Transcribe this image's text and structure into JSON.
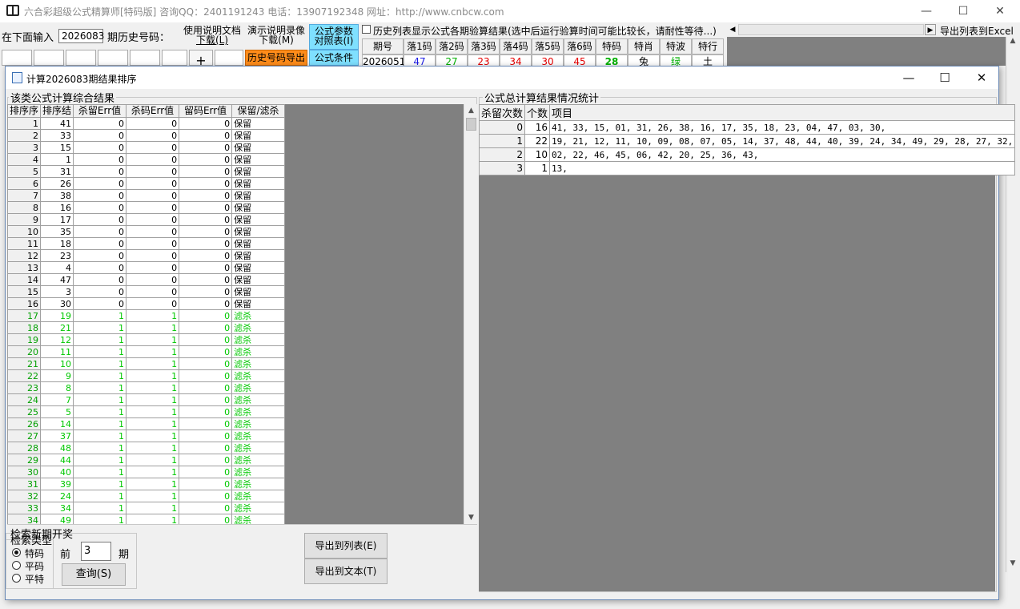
{
  "main_window": {
    "title": "六合彩超级公式精算师[特码版]  咨询QQ：2401191243  电话：13907192348  网址：http://www.cnbcw.com",
    "input_label": "在下面输入",
    "period_value": "2026083",
    "history_label": "期历史号码：",
    "btn_manual_line1": "使用说明文档",
    "btn_manual_line2": "下载(L)",
    "btn_video_line1": "演示说明录像",
    "btn_video_line2": "下载(M)",
    "btn_formula_line1": "公式参数",
    "btn_formula_line2": "对照表(I)",
    "btn_history_export": "历史号码导出",
    "btn_formula_cond": "公式条件",
    "checkbox_label": "历史列表显示公式各期验算结果(选中后运行验算时间可能比较长，请耐性等待...)",
    "export_excel": "导出列表到Excel",
    "plus": "+",
    "history_headers": [
      "期号",
      "落1码",
      "落2码",
      "落3码",
      "落4码",
      "落5码",
      "落6码",
      "特码",
      "特肖",
      "特波",
      "特行"
    ],
    "history_row": [
      "2026051",
      "47",
      "27",
      "23",
      "34",
      "30",
      "45",
      "28",
      "兔",
      "绿",
      "土"
    ],
    "history_colors": [
      "#000000",
      "#1a1ae6",
      "#00b000",
      "#e60000",
      "#e60000",
      "#e60000",
      "#e60000",
      "#00b000",
      "#000000",
      "#00b000",
      "#000000"
    ]
  },
  "dialog": {
    "title": "计算2026083期结果排序",
    "left_group_label": "该类公式计算综合结果",
    "left_headers": [
      "排序序",
      "排序结",
      "杀留Err值",
      "杀码Err值",
      "留码Err值",
      "保留/滤杀"
    ],
    "left_rows": [
      [
        "1",
        "41",
        "0",
        "0",
        "0",
        "保留"
      ],
      [
        "2",
        "33",
        "0",
        "0",
        "0",
        "保留"
      ],
      [
        "3",
        "15",
        "0",
        "0",
        "0",
        "保留"
      ],
      [
        "4",
        "1",
        "0",
        "0",
        "0",
        "保留"
      ],
      [
        "5",
        "31",
        "0",
        "0",
        "0",
        "保留"
      ],
      [
        "6",
        "26",
        "0",
        "0",
        "0",
        "保留"
      ],
      [
        "7",
        "38",
        "0",
        "0",
        "0",
        "保留"
      ],
      [
        "8",
        "16",
        "0",
        "0",
        "0",
        "保留"
      ],
      [
        "9",
        "17",
        "0",
        "0",
        "0",
        "保留"
      ],
      [
        "10",
        "35",
        "0",
        "0",
        "0",
        "保留"
      ],
      [
        "11",
        "18",
        "0",
        "0",
        "0",
        "保留"
      ],
      [
        "12",
        "23",
        "0",
        "0",
        "0",
        "保留"
      ],
      [
        "13",
        "4",
        "0",
        "0",
        "0",
        "保留"
      ],
      [
        "14",
        "47",
        "0",
        "0",
        "0",
        "保留"
      ],
      [
        "15",
        "3",
        "0",
        "0",
        "0",
        "保留"
      ],
      [
        "16",
        "30",
        "0",
        "0",
        "0",
        "保留"
      ],
      [
        "17",
        "19",
        "1",
        "1",
        "0",
        "滤杀"
      ],
      [
        "18",
        "21",
        "1",
        "1",
        "0",
        "滤杀"
      ],
      [
        "19",
        "12",
        "1",
        "1",
        "0",
        "滤杀"
      ],
      [
        "20",
        "11",
        "1",
        "1",
        "0",
        "滤杀"
      ],
      [
        "21",
        "10",
        "1",
        "1",
        "0",
        "滤杀"
      ],
      [
        "22",
        "9",
        "1",
        "1",
        "0",
        "滤杀"
      ],
      [
        "23",
        "8",
        "1",
        "1",
        "0",
        "滤杀"
      ],
      [
        "24",
        "7",
        "1",
        "1",
        "0",
        "滤杀"
      ],
      [
        "25",
        "5",
        "1",
        "1",
        "0",
        "滤杀"
      ],
      [
        "26",
        "14",
        "1",
        "1",
        "0",
        "滤杀"
      ],
      [
        "27",
        "37",
        "1",
        "1",
        "0",
        "滤杀"
      ],
      [
        "28",
        "48",
        "1",
        "1",
        "0",
        "滤杀"
      ],
      [
        "29",
        "44",
        "1",
        "1",
        "0",
        "滤杀"
      ],
      [
        "30",
        "40",
        "1",
        "1",
        "0",
        "滤杀"
      ],
      [
        "31",
        "39",
        "1",
        "1",
        "0",
        "滤杀"
      ],
      [
        "32",
        "24",
        "1",
        "1",
        "0",
        "滤杀"
      ],
      [
        "33",
        "34",
        "1",
        "1",
        "0",
        "滤杀"
      ],
      [
        "34",
        "49",
        "1",
        "1",
        "0",
        "滤杀"
      ]
    ],
    "right_group_label": "公式总计算结果情况统计",
    "right_headers": [
      "杀留次数",
      "个数",
      "项目"
    ],
    "right_rows": [
      [
        "0",
        "16",
        "41, 33, 15, 01, 31, 26, 38, 16, 17, 35, 18, 23, 04, 47, 03, 30,"
      ],
      [
        "1",
        "22",
        "19, 21, 12, 11, 10, 09, 08, 07, 05, 14, 37, 48, 44, 40, 39, 24, 34, 49, 29, 28, 27, 32,"
      ],
      [
        "2",
        "10",
        "02, 22, 46, 45, 06, 42, 20, 25, 36, 43,"
      ],
      [
        "3",
        "1",
        "13,"
      ]
    ],
    "search_group_label": "检索类型",
    "search_group_label_overlap": "检索新期开奖",
    "radio_options": [
      "特码",
      "平码",
      "平特"
    ],
    "selected_radio": "特码",
    "front_label": "前",
    "periods_value": "3",
    "period_unit": "期",
    "query_button": "查询(S)",
    "export_list_button": "导出到列表(E)",
    "export_text_button": "导出到文本(T)"
  }
}
